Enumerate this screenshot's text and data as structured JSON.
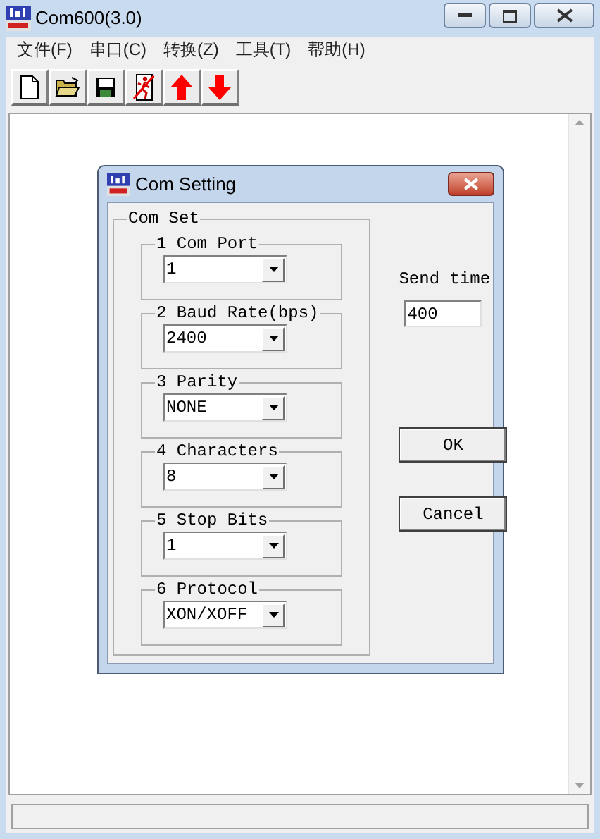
{
  "window": {
    "title": "Com600(3.0)"
  },
  "menu": [
    "文件(F)",
    "串口(C)",
    "转换(Z)",
    "工具(T)",
    "帮助(H)"
  ],
  "toolbar": [
    {
      "kind": "new"
    },
    {
      "kind": "open"
    },
    {
      "kind": "save"
    },
    {
      "kind": "exit"
    },
    {
      "kind": "up"
    },
    {
      "kind": "down"
    }
  ],
  "dialog": {
    "title": "Com Setting",
    "group": {
      "label": "Com Set",
      "fields": [
        {
          "label": "1 Com Port",
          "value": "1"
        },
        {
          "label": "2 Baud Rate(bps)",
          "value": "2400"
        },
        {
          "label": "3 Parity",
          "value": "NONE"
        },
        {
          "label": "4 Characters",
          "value": "8"
        },
        {
          "label": "5 Stop Bits",
          "value": "1"
        },
        {
          "label": "6 Protocol",
          "value": "XON/XOFF"
        }
      ]
    },
    "send_time": {
      "label": "Send time",
      "value": "400"
    },
    "buttons": [
      "OK",
      "Cancel"
    ]
  }
}
